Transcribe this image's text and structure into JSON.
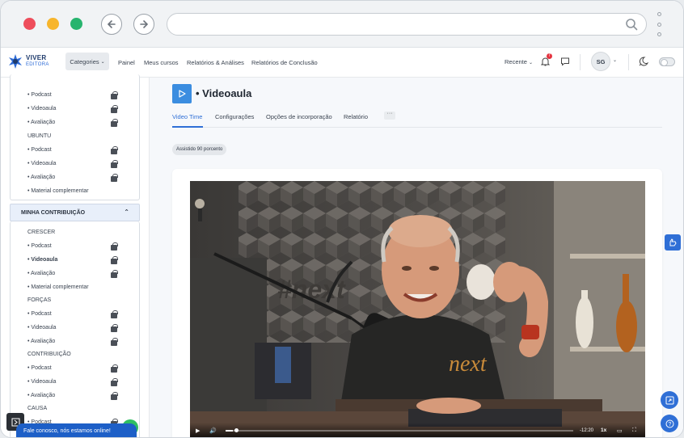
{
  "header": {
    "logo_line1": "VIVER",
    "logo_line2": "EDITORA",
    "categories_label": "Categories",
    "nav": [
      "Painel",
      "Meus cursos",
      "Relatórios & Análises",
      "Relatórios de Conclusão"
    ],
    "recent_label": "Recente",
    "notification_count": "7",
    "avatar_initials": "SG"
  },
  "sidebar": {
    "close_label": "×",
    "top_items": [
      {
        "label": "• Podcast",
        "locked": true
      },
      {
        "label": "• Videoaula",
        "locked": true
      },
      {
        "label": "• Avaliação",
        "locked": true
      }
    ],
    "ubuntu_group": "UBUNTU",
    "ubuntu_items": [
      {
        "label": "• Podcast",
        "locked": true
      },
      {
        "label": "• Videoaula",
        "locked": true
      },
      {
        "label": "• Avaliação",
        "locked": true
      },
      {
        "label": "• Material complementar",
        "locked": false
      }
    ],
    "section_title": "MINHA CONTRIBUIÇÃO",
    "groups": [
      {
        "name": "CRESCER",
        "items": [
          {
            "label": "• Podcast",
            "locked": true
          },
          {
            "label": "• Videoaula",
            "locked": true,
            "current": true
          },
          {
            "label": "• Avaliação",
            "locked": true
          },
          {
            "label": "• Material complementar",
            "locked": false
          }
        ]
      },
      {
        "name": "FORÇAS",
        "items": [
          {
            "label": "• Podcast",
            "locked": true
          },
          {
            "label": "• Videoaula",
            "locked": true
          },
          {
            "label": "• Avaliação",
            "locked": true
          }
        ]
      },
      {
        "name": "CONTRIBUIÇÃO",
        "items": [
          {
            "label": "• Podcast",
            "locked": true
          },
          {
            "label": "• Videoaula",
            "locked": true
          },
          {
            "label": "• Avaliação",
            "locked": true
          }
        ]
      },
      {
        "name": "CAUSA",
        "items": [
          {
            "label": "• Podcast",
            "locked": true
          }
        ]
      }
    ]
  },
  "main": {
    "title": "• Videoaula",
    "tabs": [
      "Video Time",
      "Configurações",
      "Opções de incorporação",
      "Relatório"
    ],
    "more_label": "···",
    "watched_badge": "Assistido 90 porcento",
    "video": {
      "time": "-12:20",
      "speed": "1x",
      "progress_fraction": 0.02,
      "wall_text": "#next",
      "shirt_text": "next"
    }
  },
  "chat": {
    "label": "Fale conosco, nós estamos online!"
  },
  "colors": {
    "accent": "#2f6fd6",
    "tab_active": "#2f6fd6",
    "notification": "#e5333f"
  }
}
